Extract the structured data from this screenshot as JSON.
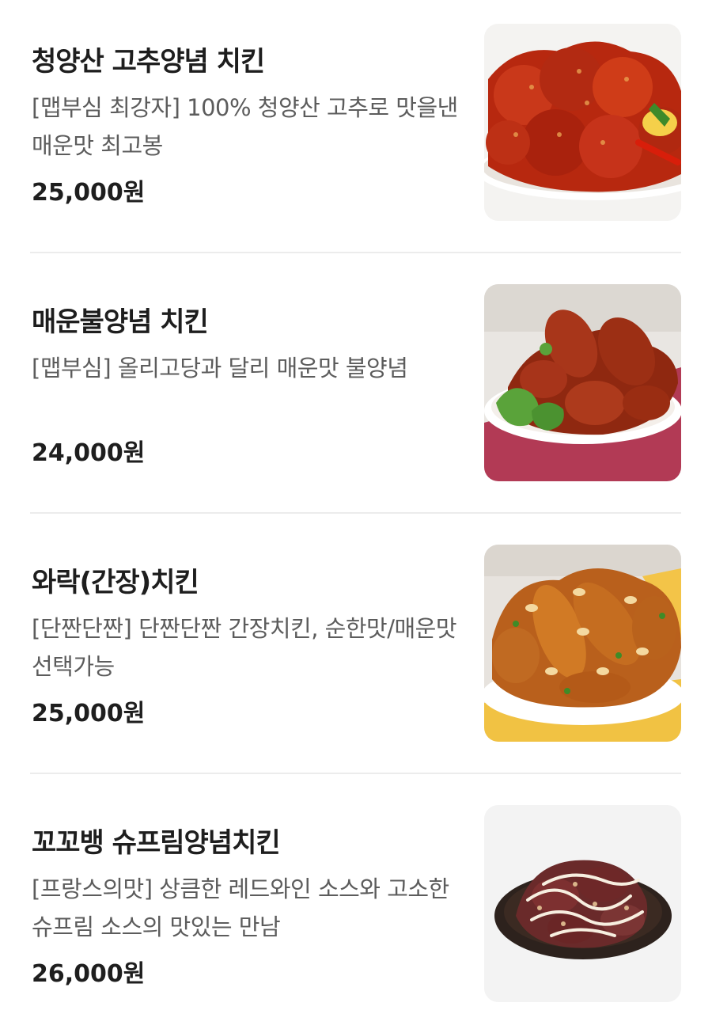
{
  "menu": {
    "items": [
      {
        "name": "청양산 고추양념 치킨",
        "description": "[맵부심 최강자] 100% 청양산 고추로 맛을낸 매운맛 최고봉",
        "price": "25,000원",
        "image_icon": "spicy-chicken-photo"
      },
      {
        "name": "매운불양념 치킨",
        "description": "[맵부심] 올리고당과 달리 매운맛 불양념",
        "price": "24,000원",
        "image_icon": "fire-chicken-photo"
      },
      {
        "name": "와락(간장)치킨",
        "description": "[단짠단짠] 단짠단짠 간장치킨, 순한맛/매운맛 선택가능",
        "price": "25,000원",
        "image_icon": "soy-chicken-photo"
      },
      {
        "name": "꼬꼬뱅 슈프림양념치킨",
        "description": "[프랑스의맛] 상큼한 레드와인 소스와 고소한 슈프림 소스의 맛있는 만남",
        "price": "26,000원",
        "image_icon": "supreme-chicken-photo"
      }
    ]
  },
  "colors": {
    "title": "#1e1e1e",
    "description": "#5c5c5c",
    "divider": "#ececec",
    "thumb_background": "#f2f2f2"
  }
}
